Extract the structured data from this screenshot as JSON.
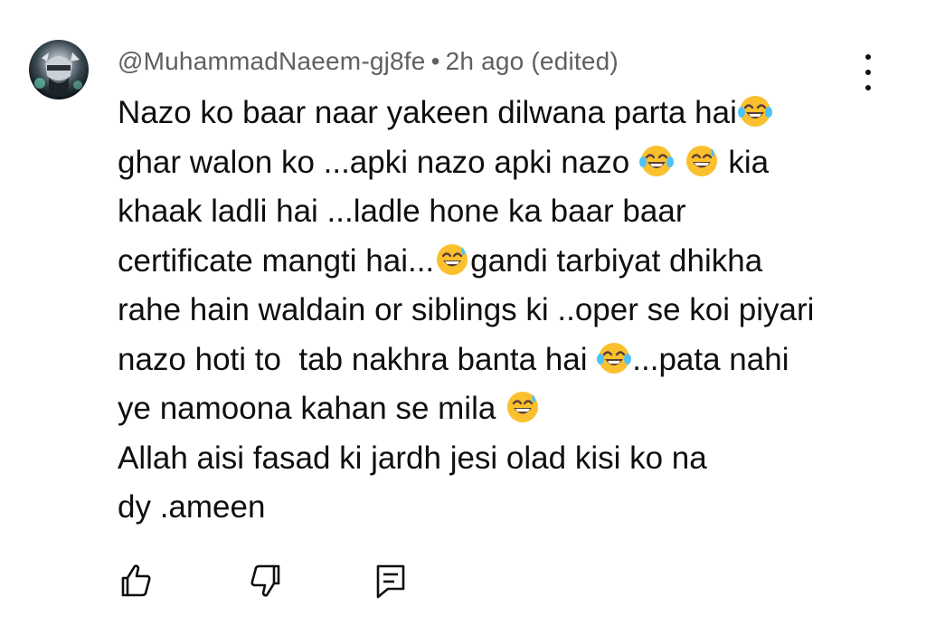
{
  "comment": {
    "author": "@MuhammadNaeem-gj8fe",
    "separator": "•",
    "timestamp": "2h ago (edited)",
    "lines": [
      [
        "Nazo ko baar naar yakeen dilwana parta hai",
        {
          "emoji": "tears-of-joy"
        }
      ],
      [
        "ghar walon ko ...apki nazo apki nazo ",
        {
          "emoji": "tears-of-joy"
        },
        " ",
        {
          "emoji": "grin-sweat"
        },
        " kia"
      ],
      [
        "khaak ladli hai ...ladle hone ka baar baar"
      ],
      [
        "certificate mangti hai...",
        {
          "emoji": "grin-sweat"
        },
        "gandi tarbiyat dhikha"
      ],
      [
        "rahe hain waldain or siblings ki ..oper se koi piyari"
      ],
      [
        "nazo hoti to  tab nakhra banta hai ",
        {
          "emoji": "tears-of-joy"
        },
        "...pata nahi"
      ],
      [
        "ye namoona kahan se mila ",
        {
          "emoji": "grin-sweat"
        }
      ],
      [
        "Allah aisi fasad ki jardh jesi olad kisi ko na"
      ],
      [
        "dy .ameen"
      ]
    ]
  },
  "icons": {
    "avatar": "avatar-image",
    "more": "more-vert-icon",
    "like": "thumb-up-icon",
    "dislike": "thumb-down-icon",
    "reply": "reply-comment-icon"
  },
  "colors": {
    "text": "#0f0f0f",
    "meta": "#606060",
    "emoji_face": "#fbc02d"
  }
}
